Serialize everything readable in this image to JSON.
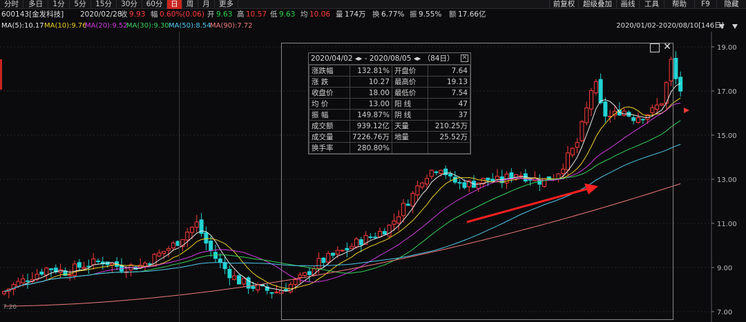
{
  "toolbar": {
    "timeframes": [
      {
        "label": "分时",
        "active": false
      },
      {
        "label": "多日",
        "active": false
      },
      {
        "label": "1分",
        "active": false
      },
      {
        "label": "5分",
        "active": false
      },
      {
        "label": "15分",
        "active": false
      },
      {
        "label": "30分",
        "active": false
      },
      {
        "label": "60分",
        "active": false
      },
      {
        "label": "日",
        "active": true
      },
      {
        "label": "周",
        "active": false
      },
      {
        "label": "月",
        "active": false
      },
      {
        "label": "更多",
        "active": false
      }
    ],
    "right_buttons": [
      "前复权",
      "超级叠加",
      "画线",
      "工具",
      "帮助",
      "F9",
      "隐藏"
    ]
  },
  "infobar": {
    "code_name": "600143[金发科技]",
    "date": "2020/02/28",
    "close_label": "收",
    "close": "9.93",
    "change_label": "幅",
    "change": "0.60%(0.06)",
    "open_label": "开",
    "open": "9.63",
    "high_label": "高",
    "high": "10.57",
    "low_label": "低",
    "low": "9.63",
    "avg_label": "均",
    "avg": "10.06",
    "volume_label": "量",
    "volume": "174万",
    "turnover_label": "换",
    "turnover": "6.77%",
    "amplitude_label": "振",
    "amplitude": "9.55%",
    "amount_label": "额",
    "amount": "17.66亿"
  },
  "ma_legend": [
    {
      "text": "MA(5):10.17",
      "color": "#e8e8e8"
    },
    {
      "text": "MA(10):9.76",
      "color": "#f0d22a"
    },
    {
      "text": "MA(20):9.52",
      "color": "#d23ce0"
    },
    {
      "text": "MA(30):9.30",
      "color": "#38d05a"
    },
    {
      "text": "MA(50):8.54",
      "color": "#52c8ee"
    },
    {
      "text": "MA(90):7.72",
      "color": "#f07c7c"
    }
  ],
  "range_label": "2020/01/02-2020/08/10[146日]",
  "y_axis": [
    "19.00",
    "17.00",
    "15.00",
    "13.00",
    "11.00",
    "9.00",
    "7.00"
  ],
  "bottom_left_label": "7.20",
  "popup": {
    "title": "2020/04/02 ◂▸ - 2020/08/05 ◂▸ （84日）",
    "close": "✕",
    "rows": [
      {
        "l1": "涨跌幅",
        "v1": "132.81%",
        "c1": "red",
        "l2": "开盘价",
        "v2": "7.64",
        "c2": "red"
      },
      {
        "l1": "涨  跌",
        "v1": "10.27",
        "c1": "red",
        "l2": "最高价",
        "v2": "19.13",
        "c2": "red"
      },
      {
        "l1": "收盘价",
        "v1": "18.00",
        "c1": "red",
        "l2": "最低价",
        "v2": "7.54",
        "c2": "red"
      },
      {
        "l1": "均  价",
        "v1": "13.00",
        "c1": "red",
        "l2": "阳  线",
        "v2": "47",
        "c2": "red"
      },
      {
        "l1": "振  幅",
        "v1": "149.87%",
        "c1": "red",
        "l2": "阴  线",
        "v2": "37",
        "c2": "grn"
      },
      {
        "l1": "成交额",
        "v1": "939.12亿",
        "c1": "wht",
        "l2": "天量",
        "v2": "210.25万",
        "c2": "wht"
      },
      {
        "l1": "成交量",
        "v1": "7226.76万",
        "c1": "wht",
        "l2": "地量",
        "v2": "25.52万",
        "c2": "wht"
      },
      {
        "l1": "换手率",
        "v1": "280.80%",
        "c1": "wht",
        "l2": "",
        "v2": "",
        "c2": "wht"
      }
    ]
  },
  "colors": {
    "up": "#ff3b3b",
    "down": "#22d3d3",
    "arrow": "#ff2020"
  }
}
